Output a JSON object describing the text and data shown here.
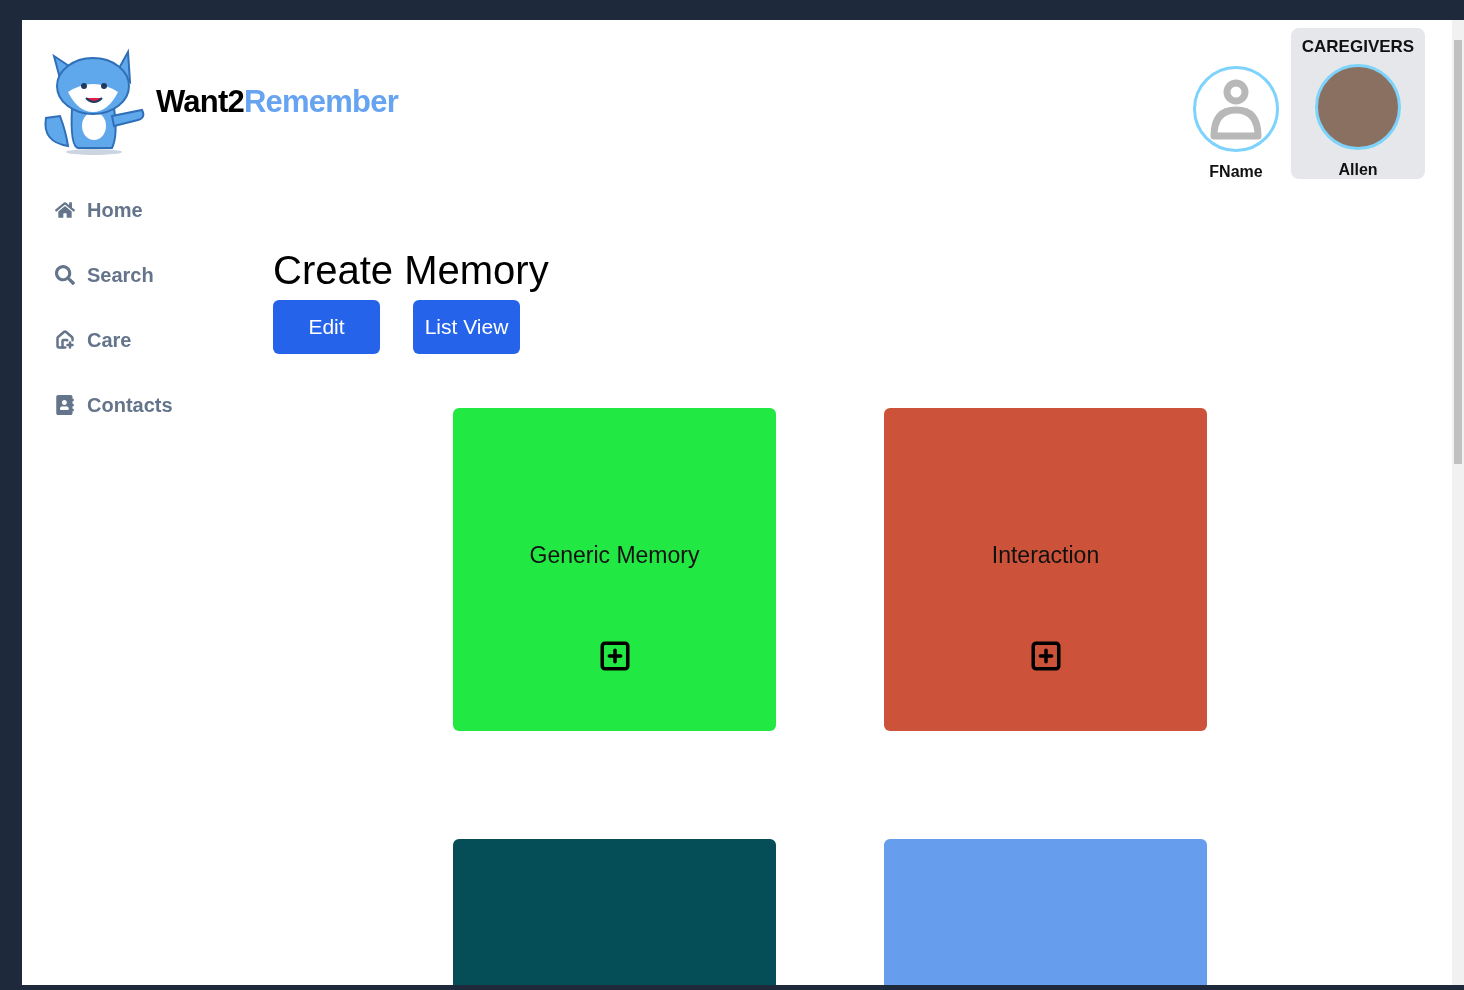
{
  "brand": {
    "part_1": "Want2",
    "part_2": "Remember"
  },
  "nav": [
    {
      "label": "Home",
      "kind": "home"
    },
    {
      "label": "Search",
      "kind": "search"
    },
    {
      "label": "Care",
      "kind": "care"
    },
    {
      "label": "Contacts",
      "kind": "contacts"
    }
  ],
  "profile": {
    "name": "FName"
  },
  "caregivers": {
    "heading": "CAREGIVERS",
    "people": [
      {
        "name": "Allen"
      }
    ]
  },
  "page_title": "Create Memory",
  "buttons": [
    "Edit",
    "List View"
  ],
  "cards": [
    {
      "title": "Generic Memory",
      "color": "#22e843"
    },
    {
      "title": "Interaction",
      "color": "#cc533a"
    },
    {
      "color": "#064e57"
    },
    {
      "color": "#669ded"
    }
  ]
}
